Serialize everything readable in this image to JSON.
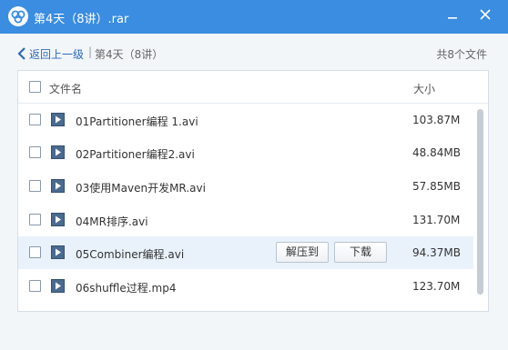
{
  "window": {
    "title": "第4天（8讲）.rar",
    "icons": {
      "app": "baidu-cloud-icon",
      "minimize": "minimize-icon",
      "close": "close-icon"
    },
    "titlebar_color": "#3a8de0"
  },
  "nav": {
    "back_label": "返回上一级",
    "separator": "|",
    "current_folder": "第4天（8讲）",
    "file_count": "共8个文件"
  },
  "table": {
    "col_name": "文件名",
    "col_size": "大小",
    "rows": [
      {
        "name": "01Partitioner编程 1.avi",
        "size": "103.87M"
      },
      {
        "name": "02Partitioner编程2.avi",
        "size": "48.84MB"
      },
      {
        "name": "03使用Maven开发MR.avi",
        "size": "57.85MB"
      },
      {
        "name": "04MR排序.avi",
        "size": "131.70M"
      },
      {
        "name": "05Combiner编程.avi",
        "size": "94.37MB"
      },
      {
        "name": "06shuffle过程.mp4",
        "size": "123.70M"
      }
    ],
    "row_actions": {
      "extract": "解压到",
      "download": "下载"
    }
  }
}
